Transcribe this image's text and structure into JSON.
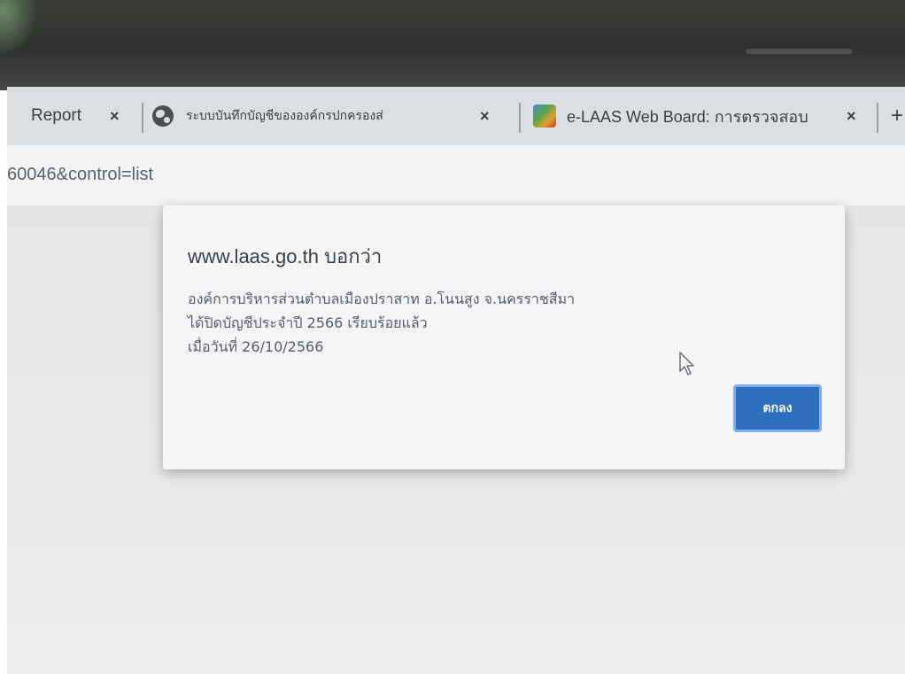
{
  "browser": {
    "tabs": [
      {
        "title": "Report",
        "close": "×",
        "icon": "none"
      },
      {
        "title": "ระบบบันทึกบัญชีขององค์กรปกครองส่",
        "close": "×",
        "icon": "globe-icon"
      },
      {
        "title": "e-LAAS Web Board: การตรวจสอบ",
        "close": "×",
        "icon": "e-laas-favicon"
      }
    ],
    "new_tab": "+",
    "url": "60046&control=list"
  },
  "dialog": {
    "origin": "www.laas.go.th บอกว่า",
    "message_lines": [
      "องค์การบริหารส่วนตำบลเมืองปราสาท อ.โนนสูง จ.นครราชสีมา",
      "ได้ปิดบัญชีประจำปี 2566 เรียบร้อยแล้ว",
      "เมื่อวันที่ 26/10/2566"
    ],
    "ok_label": "ตกลง"
  },
  "colors": {
    "ok_button": "#2e6fc0",
    "dialog_bg": "#f4f5f7",
    "tabbar_bg": "#dcdfe2"
  }
}
